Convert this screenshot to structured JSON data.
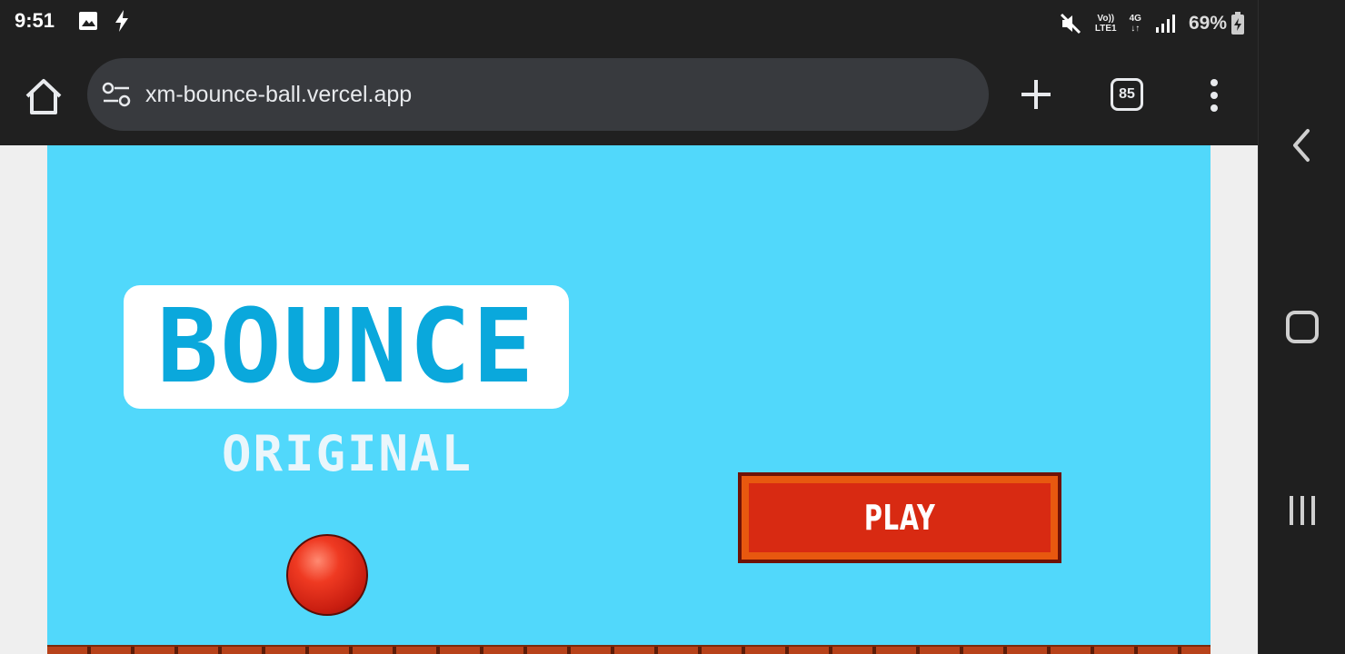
{
  "status_bar": {
    "time": "9:51",
    "icons": [
      "image-notification-icon",
      "flash-icon",
      "mute-icon",
      "volte-icon",
      "4g-icon",
      "signal-icon",
      "battery-icon"
    ],
    "volte_line1": "Vo))",
    "volte_line2": "LTE1",
    "network_line1": "4G",
    "network_line2": "↓↑",
    "battery": "69%"
  },
  "browser": {
    "url": "xm-bounce-ball.vercel.app",
    "tab_count": "85"
  },
  "game": {
    "title": "BOUNCE",
    "subtitle": "ORIGINAL",
    "play_label": "PLAY",
    "colors": {
      "sky": "#51d8fb",
      "logo_text": "#0aa8dc",
      "play_button": "#d82a12",
      "ball": "#ef3a22"
    }
  },
  "nav": {
    "buttons": [
      "back",
      "home",
      "recents"
    ]
  }
}
